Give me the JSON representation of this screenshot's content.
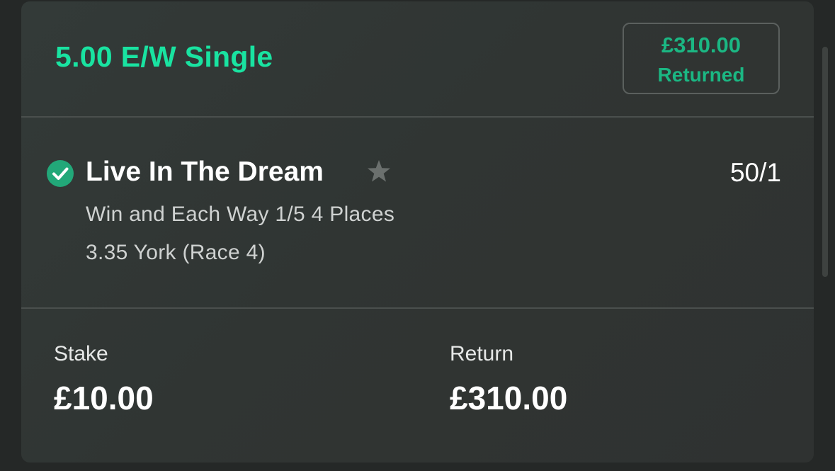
{
  "bet": {
    "title": "5.00 E/W Single",
    "returned_amount": "£310.00",
    "returned_label": "Returned"
  },
  "selection": {
    "name": "Live In The Dream",
    "odds": "50/1",
    "market": "Win and Each Way 1/5 4 Places",
    "event": "3.35 York (Race 4)",
    "status_icon": "check-circle-icon",
    "favourite_icon": "star-icon"
  },
  "summary": {
    "stake_label": "Stake",
    "stake_value": "£10.00",
    "return_label": "Return",
    "return_value": "£310.00"
  },
  "colors": {
    "accent_green": "#19e3a1",
    "returned_green": "#1bb783",
    "check_green": "#22a879",
    "card_background": "#313634",
    "page_background": "#252827"
  }
}
